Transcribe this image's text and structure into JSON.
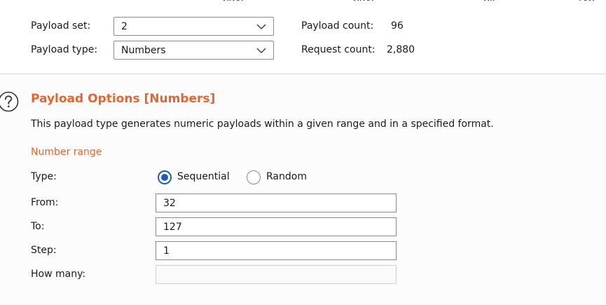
{
  "top_partial_text": [
    "payl",
    "payl",
    "ple",
    "typ"
  ],
  "payload_set": {
    "label": "Payload set:",
    "value": "2"
  },
  "payload_type": {
    "label": "Payload type:",
    "value": "Numbers"
  },
  "payload_count": {
    "label": "Payload count:",
    "value": "96"
  },
  "request_count": {
    "label": "Request count:",
    "value": "2,880"
  },
  "options": {
    "title": "Payload Options [Numbers]",
    "description": "This payload type generates numeric payloads within a given range and in a specified format.",
    "number_range_heading": "Number range",
    "type_label": "Type:",
    "type_options": [
      "Sequential",
      "Random"
    ],
    "type_selected": "Sequential",
    "from_label": "From:",
    "from_value": "32",
    "to_label": "To:",
    "to_value": "127",
    "step_label": "Step:",
    "step_value": "1",
    "how_many_label": "How many:",
    "how_many_value": ""
  },
  "colors": {
    "accent": "#e8642a",
    "radio_selected": "#1f5fae"
  }
}
